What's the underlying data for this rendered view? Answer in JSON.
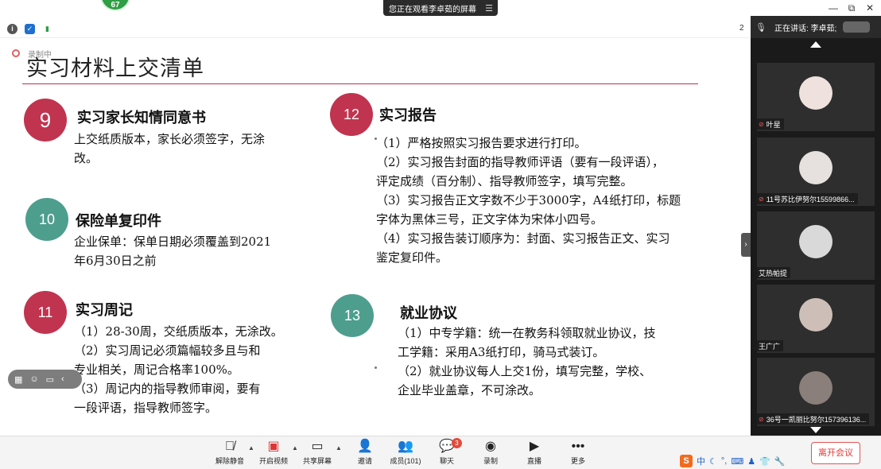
{
  "top": {
    "badge_number": "67",
    "share_notice": "您正在观看李卓茹的屏幕",
    "share_menu_icon": "menu-lines-icon",
    "min_icon": "—",
    "restore_icon": "⧉",
    "close_icon": "✕"
  },
  "infobar": {
    "edge_text": "2"
  },
  "slide": {
    "rec_label": "录制中",
    "title": "实习材料上交清单",
    "sections": [
      {
        "num": "9",
        "title": "实习家长知情同意书",
        "lines": [
          "上交纸质版本，家长必须签字，无涂",
          "改。"
        ]
      },
      {
        "num": "10",
        "title": "保险单复印件",
        "lines": [
          "企业保单：保单日期必须覆盖到2021",
          "年6月30日之前"
        ]
      },
      {
        "num": "11",
        "title": "实习周记",
        "lines": [
          "（1）28-30周，交纸质版本，无涂改。",
          "（2）实习周记必须篇幅较多且与和",
          "专业相关，周记合格率100%。",
          "（3）周记内的指导教师审阅，要有",
          "一段评语，指导教师签字。"
        ]
      },
      {
        "num": "12",
        "title": "实习报告",
        "lines": [
          "（1）严格按照实习报告要求进行打印。",
          "（2）实习报告封面的指导教师评语（要有一段评语），",
          "评定成绩（百分制）、指导教师签字，填写完整。",
          "（3）实习报告正文字数不少于3000字，A4纸打印，标题",
          "字体为黑体三号，正文字体为宋体小四号。",
          "（4）实习报告装订顺序为：封面、实习报告正文、实习",
          "鉴定复印件。"
        ]
      },
      {
        "num": "13",
        "title": "就业协议",
        "lines": [
          "（1）中专学籍：统一在教务科领取就业协议，技",
          "工学籍：采用A3纸打印，骑马式装订。",
          "（2）就业协议每人上交1份，填写完整，学校、",
          "企业毕业盖章，不可涂改。"
        ]
      }
    ]
  },
  "panel": {
    "speaking_label": "正在讲话: 李卓茹;",
    "participants": [
      {
        "name": "叶星",
        "muted": true
      },
      {
        "name": "11号苏比伊努尔15599866...",
        "muted": true
      },
      {
        "name": "艾热帕提",
        "muted": false
      },
      {
        "name": "王广广",
        "muted": false
      },
      {
        "name": "36号一凯丽比努尔157396136...",
        "muted": true
      }
    ]
  },
  "toolbar": {
    "items": [
      {
        "label": "解除静音",
        "icon": "mic-muted-icon"
      },
      {
        "label": "开启视频",
        "icon": "video-off-icon"
      },
      {
        "label": "共享屏幕",
        "icon": "share-screen-icon"
      },
      {
        "label": "邀请",
        "icon": "invite-icon"
      },
      {
        "label": "成员(101)",
        "icon": "members-icon"
      },
      {
        "label": "聊天",
        "icon": "chat-icon"
      },
      {
        "label": "录制",
        "icon": "record-icon"
      },
      {
        "label": "直播",
        "icon": "live-icon"
      },
      {
        "label": "更多",
        "icon": "more-icon"
      }
    ],
    "chat_badge": "3",
    "ime_label": "中",
    "leave_label": "离开会议"
  }
}
